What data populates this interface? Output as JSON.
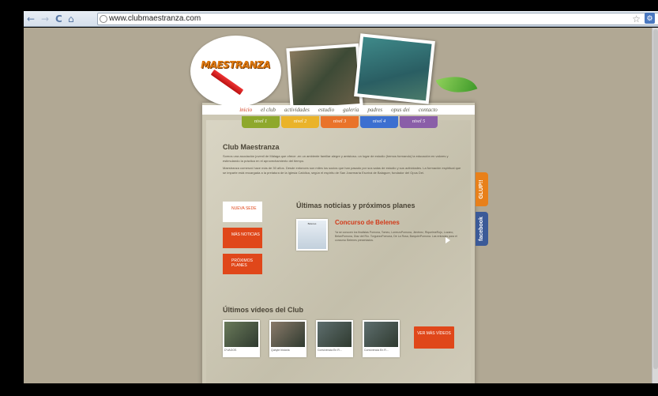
{
  "browser": {
    "url": "www.clubmaestranza.com",
    "back_icon": "←",
    "forward_icon": "→",
    "reload_icon": "C",
    "home_icon": "⌂",
    "star_icon": "☆",
    "wrench_icon": "🔧"
  },
  "header": {
    "logo_text": "MAESTRANZA"
  },
  "menu": {
    "items": [
      "inicio",
      "el club",
      "actividades",
      "estudio",
      "galería",
      "padres",
      "opus dei",
      "contacto"
    ]
  },
  "levels": [
    {
      "label": "nivel 1",
      "color": "#8ea82c"
    },
    {
      "label": "nivel 2",
      "color": "#eab32a"
    },
    {
      "label": "nivel 3",
      "color": "#e9732a"
    },
    {
      "label": "nivel 4",
      "color": "#3c6fd0"
    },
    {
      "label": "nivel 5",
      "color": "#8a5ea8"
    }
  ],
  "club": {
    "title": "Club Maestranza",
    "intro1": "Somos una asociación juvenil de Málaga que ofrece -en un ambiente familiar alegre y amistoso- un lugar de estudio (hemos formando) la educación en valores y estimulando la práctica en el aprovechamiento del tiempo.",
    "intro2": "Maestranza comenzó hace más de 30 años. Desde entonces son miles los socios que han pasado por sus salas de estudio y sus actividades. La formación espiritual que se imparte está encargada a la prelatura de la Iglesia Católica, según el espíritu de San Josemaría Escrivá de Balaguer, fundador del Opus Dei."
  },
  "side_buttons": [
    {
      "label": "NUEVA SEDE",
      "bg": "#ffffff",
      "color": "#e0471a"
    },
    {
      "label": "MÁS NOTICIAS",
      "bg": "#e0471a",
      "color": "#ffffff"
    },
    {
      "label": "PRÓXIMOS PLANES",
      "bg": "#e0471a",
      "color": "#ffffff"
    }
  ],
  "news": {
    "title": "Últimas noticias y próximos planes",
    "headline": "Concurso de Belenes",
    "thumb_caption": "Belenes",
    "body": "Ya se conocen los finalistas Pomona, Tomeo, LorenzoPomona, Jiménez, RiquelmeRojo, Lozano, BelanPomona, Diaz del Río. TorguezoPomona, De La Rosa, BarquierPomona. Las entradas para el concurso Belenes presentados."
  },
  "videos": {
    "title": "Últimos vídeos del Club",
    "items": [
      {
        "caption": "D'VAGOS",
        "color": "#6a7a5a"
      },
      {
        "caption": "Qubyte historia",
        "color": "#8a7a6a"
      },
      {
        "caption": "Convivencia En R...",
        "color": "#5e6e6e"
      },
      {
        "caption": "Convivencia En R...",
        "color": "#5e6e6e"
      }
    ],
    "more_label": "VER MÁS VÍDEOS"
  },
  "tabs": {
    "glup": "GLUP!!",
    "facebook": "facebook"
  }
}
